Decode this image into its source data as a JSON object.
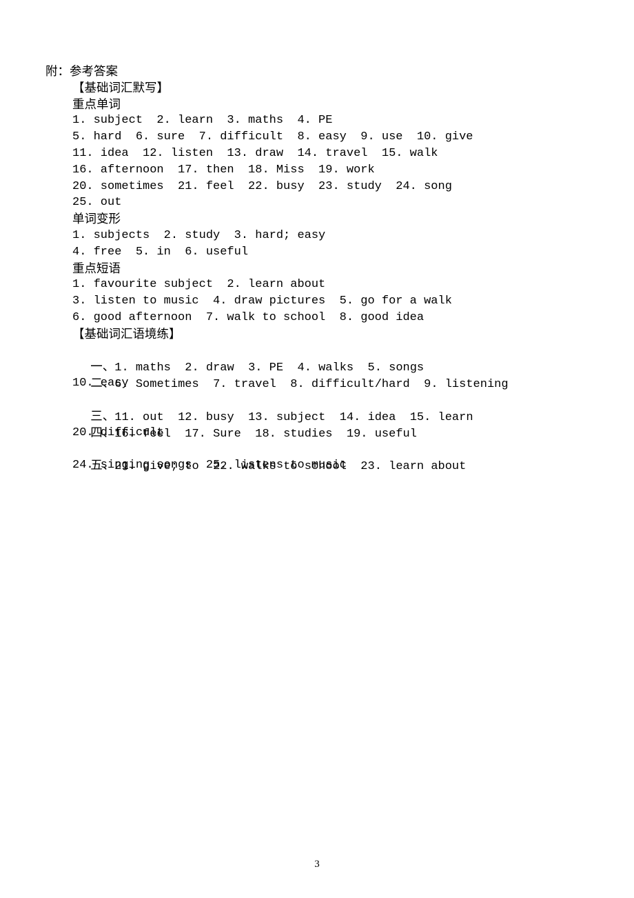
{
  "document": {
    "page_number": "3",
    "heading": "附：参考答案",
    "sections": [
      {
        "title": "【基础词汇默写】",
        "subsections": [
          {
            "label": "重点单词",
            "lines": [
              "1. subject  2. learn  3. maths  4. PE",
              "5. hard  6. sure  7. difficult  8. easy  9. use  10. give",
              "11. idea  12. listen  13. draw  14. travel  15. walk",
              "16. afternoon  17. then  18. Miss  19. work",
              "20. sometimes  21. feel  22. busy  23. study  24. song",
              "25. out"
            ]
          },
          {
            "label": "单词变形",
            "lines": [
              "1. subjects  2. study  3. hard; easy",
              "4. free  5. in  6. useful"
            ]
          },
          {
            "label": "重点短语",
            "lines": [
              "1. favourite subject  2. learn about",
              "3. listen to music  4. draw pictures  5. go for a walk",
              "6. good afternoon  7. walk to school  8. good idea"
            ]
          }
        ]
      },
      {
        "title": "【基础词汇语境练】",
        "groups": [
          {
            "marker": "一、",
            "lines": [
              "1. maths  2. draw  3. PE  4. walks  5. songs"
            ]
          },
          {
            "marker": "二、",
            "lines": [
              "6. Sometimes  7. travel  8. difficult/hard  9. listening",
              "10. easy"
            ]
          },
          {
            "marker": "三、",
            "lines": [
              "11. out  12. busy  13. subject  14. idea  15. learn"
            ]
          },
          {
            "marker": "四、",
            "lines": [
              "16. feel  17. Sure  18. studies  19. useful",
              "20. difficult"
            ]
          },
          {
            "marker": "五、",
            "lines": [
              "21. give; to  22. walks to school  23. learn about",
              "24. singing songs  25. listens to music"
            ]
          }
        ]
      }
    ]
  }
}
